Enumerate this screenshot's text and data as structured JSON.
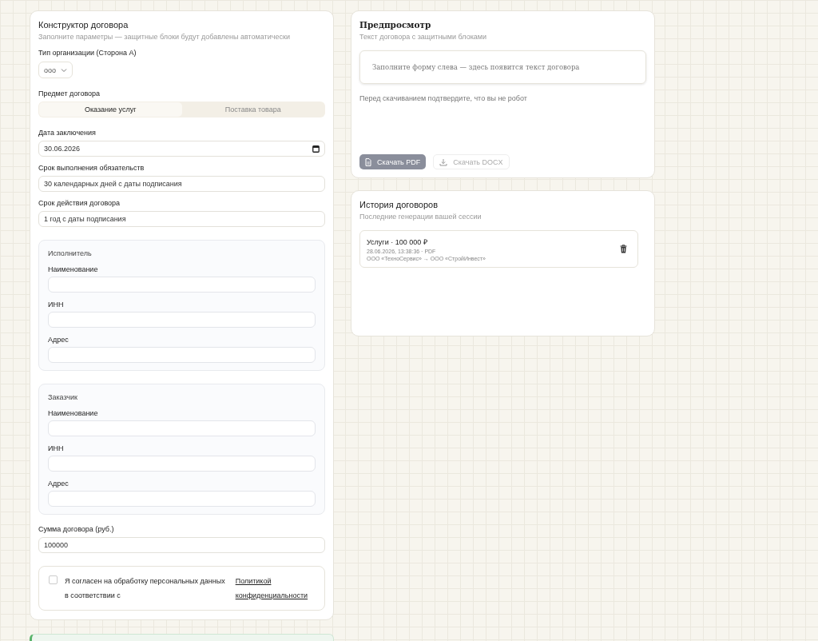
{
  "constructor": {
    "title": "Конструктор договора",
    "subtitle": "Заполните параметры — защитные блоки будут добавлены автоматически",
    "organization_type": {
      "label": "Тип организации (Сторона А)",
      "value": "ооо"
    },
    "subject": {
      "label": "Предмет договора",
      "options": [
        {
          "label": "Оказание услуг",
          "selected": true
        },
        {
          "label": "Поставка товара",
          "selected": false
        }
      ]
    },
    "date": {
      "label": "Дата заключения",
      "value": "30.06.2026"
    },
    "term": {
      "label": "Срок выполнения обязательств",
      "value": "30 календарных дней с даты подписания"
    },
    "validity": {
      "label": "Срок действия договора",
      "value": "1 год с даты подписания"
    },
    "parties": [
      {
        "title": "Исполнитель",
        "fields": [
          {
            "label": "Наименование"
          },
          {
            "label": "ИНН"
          },
          {
            "label": "Адрес"
          }
        ]
      },
      {
        "title": "Заказчик",
        "fields": [
          {
            "label": "Наименование"
          },
          {
            "label": "ИНН"
          },
          {
            "label": "Адрес"
          }
        ]
      }
    ],
    "amount": {
      "label": "Сумма договора (руб.)",
      "value": "100000"
    },
    "consent": {
      "checked": false,
      "text": "Я согласен на обработку персональных данных в соответствии с",
      "link": "Политикой конфиденциальности"
    }
  },
  "preview": {
    "title": "Предпросмотр",
    "subtitle": "Текст договора с защитными блоками",
    "placeholder": "Заполните форму слева — здесь появится текст договора",
    "captcha_note": "Перед скачиванием подтвердите, что вы не робот",
    "buttons": [
      {
        "kind": "pdf",
        "label": "Скачать PDF"
      },
      {
        "kind": "docx",
        "label": "Скачать DOCX"
      }
    ]
  },
  "history": {
    "title": "История договоров",
    "subtitle": "Последние генерации вашей сессии",
    "items": [
      {
        "title": "Услуги · 100 000 ₽",
        "meta": "28.06.2026, 13:38:36 · PDF",
        "parties": "ООО «ТехноСервис» → ООО «СтройИнвест»"
      }
    ]
  }
}
